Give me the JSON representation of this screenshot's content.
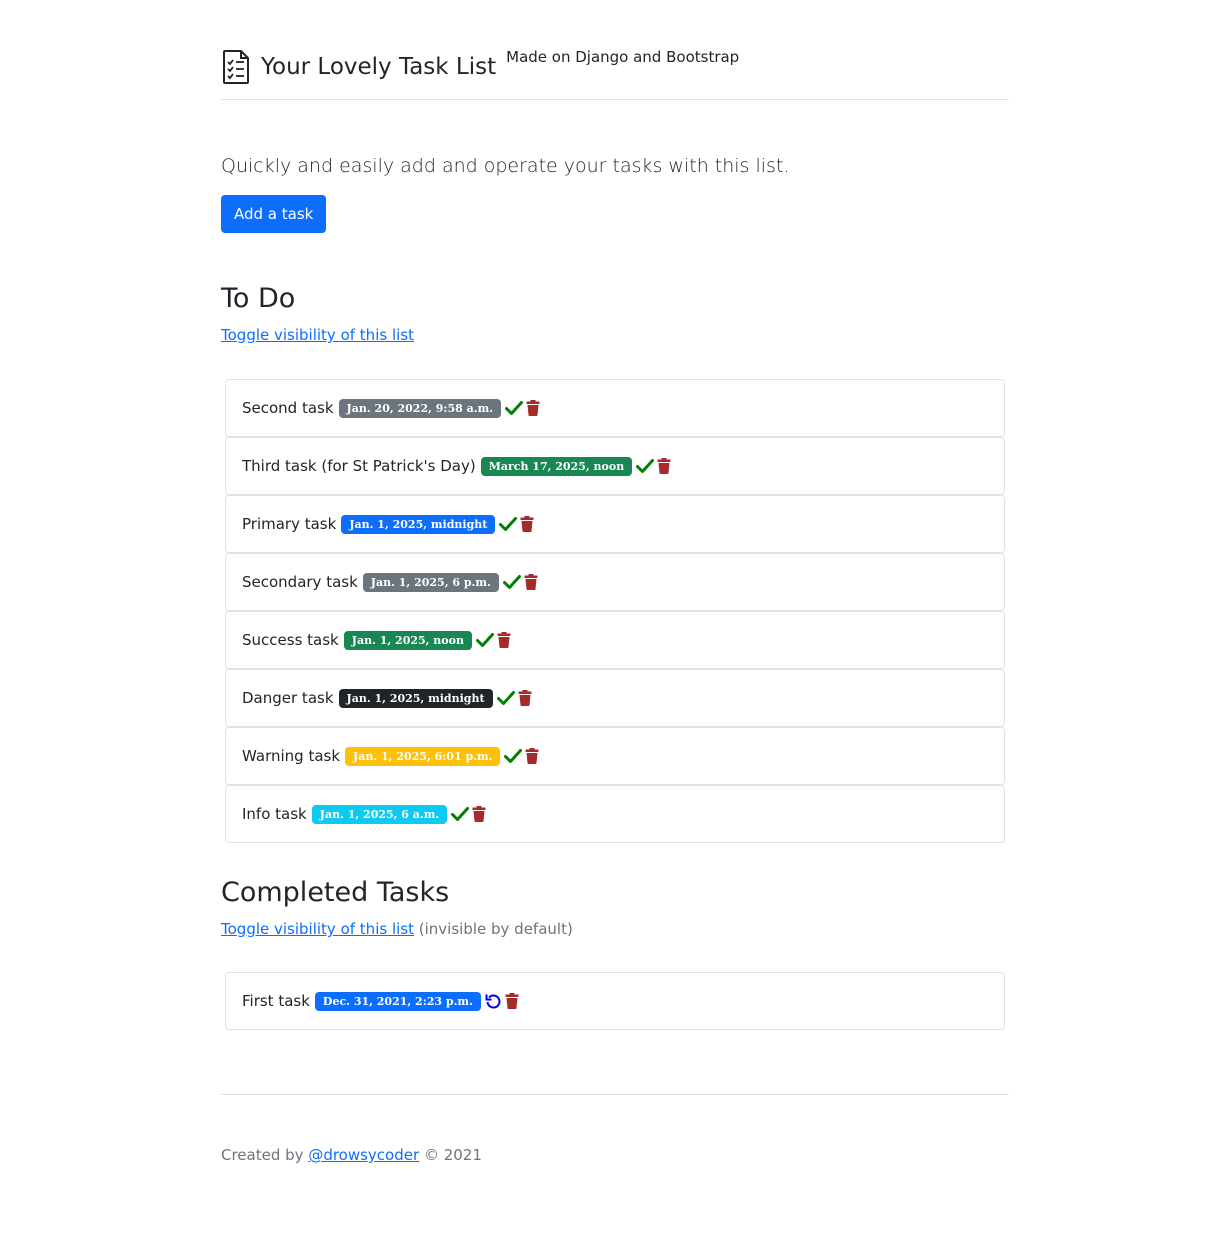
{
  "header": {
    "title": "Your Lovely Task List",
    "subtitle": "Made on Django and Bootstrap",
    "icon": "checklist-document-icon"
  },
  "intro": {
    "lead": "Quickly and easily add and operate your tasks with this list.",
    "add_button": "Add a task"
  },
  "todo": {
    "title": "To Do",
    "toggle_label": "Toggle visibility of this list",
    "items": [
      {
        "name": "Second task",
        "date": "Jan. 20, 2022, 9:58 a.m.",
        "badge_color": "#6c757d"
      },
      {
        "name": "Third task (for St Patrick's Day)",
        "date": "March 17, 2025, noon",
        "badge_color": "#198754"
      },
      {
        "name": "Primary task",
        "date": "Jan. 1, 2025, midnight",
        "badge_color": "#0d6efd"
      },
      {
        "name": "Secondary task",
        "date": "Jan. 1, 2025, 6 p.m.",
        "badge_color": "#6c757d"
      },
      {
        "name": "Success task",
        "date": "Jan. 1, 2025, noon",
        "badge_color": "#198754"
      },
      {
        "name": "Danger task",
        "date": "Jan. 1, 2025, midnight",
        "badge_color": "#212529"
      },
      {
        "name": "Warning task",
        "date": "Jan. 1, 2025, 6:01 p.m.",
        "badge_color": "#ffc107"
      },
      {
        "name": "Info task",
        "date": "Jan. 1, 2025, 6 a.m.",
        "badge_color": "#0dcaf0"
      }
    ]
  },
  "completed": {
    "title": "Completed Tasks",
    "toggle_label": "Toggle visibility of this list",
    "note": "(invisible by default)",
    "items": [
      {
        "name": "First task",
        "date": "Dec. 31, 2021, 2:23 p.m.",
        "badge_color": "#0d6efd"
      }
    ]
  },
  "footer": {
    "prefix": "Created by",
    "author": "@drowsycoder",
    "suffix": "© 2021"
  },
  "colors": {
    "check": "#008000",
    "trash": "#a52a2a",
    "undo": "#0000ff",
    "primary": "#0d6efd"
  }
}
